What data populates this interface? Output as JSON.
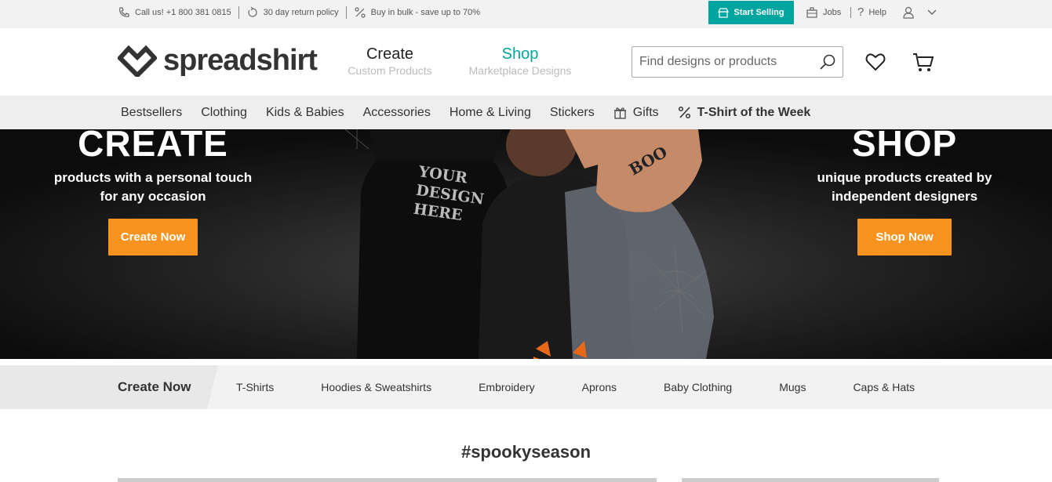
{
  "topbar": {
    "phone": "Call us! +1 800 381 0815",
    "returns": "30 day return policy",
    "bulk": "Buy in bulk - save up to 70%",
    "start_selling": "Start Selling",
    "jobs": "Jobs",
    "help": "Help"
  },
  "header": {
    "logo_text": "spreadshirt",
    "create_label": "Create",
    "create_sub": "Custom Products",
    "shop_label": "Shop",
    "shop_sub": "Marketplace Designs",
    "search_placeholder": "Find designs or products"
  },
  "categories": [
    "Bestsellers",
    "Clothing",
    "Kids & Babies",
    "Accessories",
    "Home & Living",
    "Stickers",
    "Gifts",
    "T-Shirt of the Week"
  ],
  "hero": {
    "left_title": "CREATE",
    "left_sub1": "products with a personal touch",
    "left_sub2": "for any occasion",
    "left_button": "Create Now",
    "right_title": "SHOP",
    "right_sub1": "unique products created by",
    "right_sub2": "independent designers",
    "right_button": "Shop Now",
    "shirt_text": "YOUR DESIGN HERE",
    "hand_text": "BOO"
  },
  "strip": {
    "label": "Create Now",
    "links": [
      "T-Shirts",
      "Hoodies & Sweatshirts",
      "Embroidery",
      "Aprons",
      "Baby Clothing",
      "Mugs",
      "Caps & Hats"
    ]
  },
  "section_title": "#spookyseason",
  "colors": {
    "accent": "#00a5a0",
    "button": "#f7931e"
  }
}
